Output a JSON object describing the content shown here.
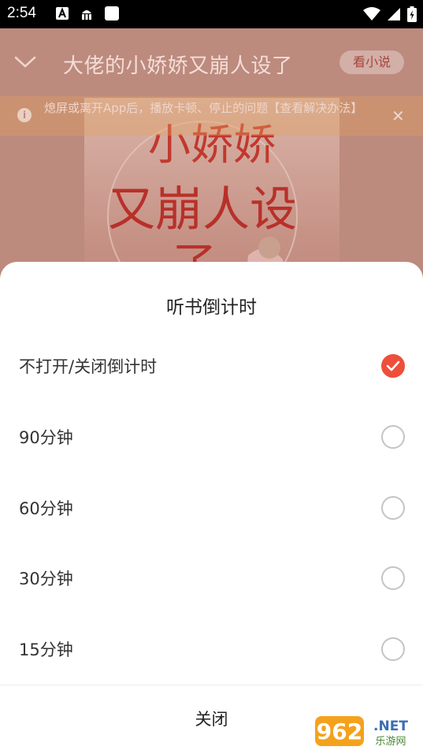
{
  "status_bar": {
    "time": "2:54"
  },
  "app": {
    "title": "大佬的小娇娇又崩人设了",
    "read_novel_button": "看小说",
    "notice_text": "熄屏或离开App后，播放卡顿、停止的问题【查看解决办法】",
    "notice_close": "✕",
    "cover_title_line1": "小娇娇",
    "cover_title_line2": "又崩人设",
    "cover_title_line3": "了"
  },
  "sheet": {
    "title": "听书倒计时",
    "options": [
      {
        "label": "不打开/关闭倒计时",
        "checked": true
      },
      {
        "label": "90分钟",
        "checked": false
      },
      {
        "label": "60分钟",
        "checked": false
      },
      {
        "label": "30分钟",
        "checked": false
      },
      {
        "label": "15分钟",
        "checked": false
      }
    ],
    "close_label": "关闭"
  },
  "watermark": {
    "number": "962",
    "suffix": ".NET",
    "caption": "乐游网"
  },
  "colors": {
    "accent": "#ee4f3a",
    "overlay": "#bd8a7e"
  }
}
